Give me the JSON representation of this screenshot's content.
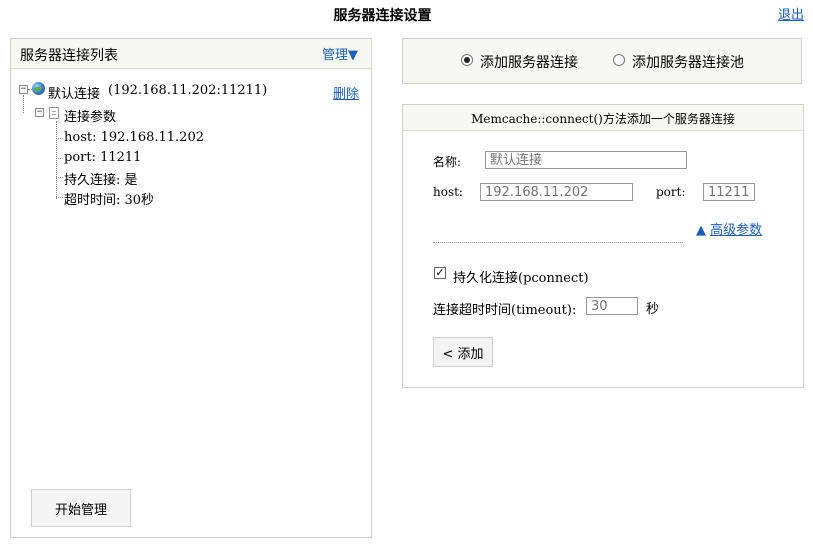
{
  "header": {
    "title": "服务器连接设置",
    "logout_label": "退出"
  },
  "left_panel": {
    "title": "服务器连接列表",
    "manage_label": "管理▼",
    "connection": {
      "name": "默认连接",
      "address": "(192.168.11.202:11211)",
      "delete_label": "删除",
      "params_label": "连接参数",
      "params": [
        "host: 192.168.11.202",
        "port: 11211",
        "持久连接: 是",
        "超时时间: 30秒"
      ]
    },
    "start_button_label": "开始管理"
  },
  "mode_select": {
    "options": [
      {
        "label": "添加服务器连接",
        "checked": true
      },
      {
        "label": "添加服务器连接池",
        "checked": false
      }
    ]
  },
  "form": {
    "title": "Memcache::connect()方法添加一个服务器连接",
    "name_label": "名称:",
    "name_placeholder": "默认连接",
    "host_label": "host:",
    "host_placeholder": "192.168.11.202",
    "port_label": "port:",
    "port_placeholder": "11211",
    "advanced_arrow": "▲",
    "advanced_label": "高级参数",
    "pconnect_label": "持久化连接(pconnect)",
    "pconnect_checked": true,
    "timeout_label": "连接超时时间(timeout):",
    "timeout_placeholder": "30",
    "timeout_unit": "秒",
    "add_button_label": "< 添加"
  },
  "colors": {
    "link": "#1a5fbf",
    "panel_header_bg": "#f7f7f4",
    "border": "#cfcfcf"
  }
}
